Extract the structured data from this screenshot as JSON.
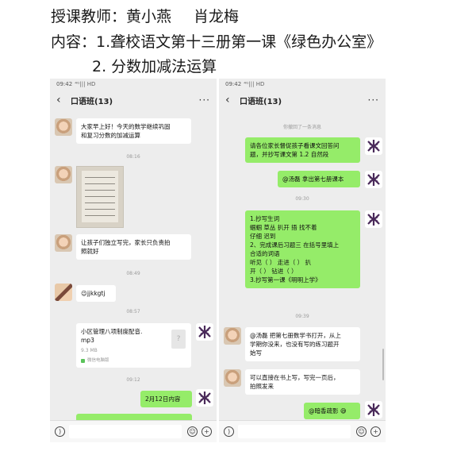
{
  "document": {
    "teachers_label": "授课教师：黄小燕",
    "teacher2": "肖龙梅",
    "content_label": "内容：",
    "content_item1": "1.聋校语文第十三册第一课《绿色办公室》",
    "content_item2": "2. 分数加减法运算"
  },
  "left_phone": {
    "status_time": "09:42",
    "status_icons": "⁴ᴳ|||  HD",
    "title": "口语班(13)",
    "messages": {
      "m1": [
        "大家早上好！今天的数学继续巩固",
        "和复习分数的加减运算"
      ],
      "t1": "08:16",
      "m2": [
        "让孩子们独立写完，家长只负责拍",
        "照就好"
      ],
      "t2": "08:49",
      "m3": "😉jjkkgtj",
      "t3": "08:57",
      "file_name_1": "小区管理八项制度配音.",
      "file_name_2": "mp3",
      "file_size": "9.3 MB",
      "file_source": "微信电脑版",
      "t4": "09:12",
      "m4": "2月12日内容"
    }
  },
  "right_phone": {
    "status_time": "09:42",
    "status_icons": "⁴ᴳ|||  HD",
    "title": "口语班(13)",
    "messages": {
      "recall": "你撤回了一条消息",
      "m1": [
        "请各位家长督促孩子看课文回答问",
        "题，并抄写课文第 1.2 自然段"
      ],
      "m2": "@汤磊  拿出第七册课本",
      "t1": "09:30",
      "m3": [
        "1.抄写生词",
        "蝈蝈   草丛   扒开   捂    找不着",
        "仔细     迟到",
        "2、完成课后习题三  在括号里填上",
        "合适的词语",
        "听见（    ）      走进（    ）     扒",
        "开（    ）    钻进（    ）",
        "3.抄写第一课《明明上学》"
      ],
      "t2": "09:39",
      "m4": [
        "@汤磊  把第七册数学书打开，从上",
        "学期你没来，也没有写的练习题开",
        "始写"
      ],
      "m5": [
        "可以直接在书上写，写完一页后，",
        "拍照发来"
      ],
      "m6": "@暗香疏影 😅"
    }
  },
  "colors": {
    "chat_bg": "#ededed",
    "sent_bubble": "#95ec69",
    "received_bubble": "#ffffff"
  }
}
